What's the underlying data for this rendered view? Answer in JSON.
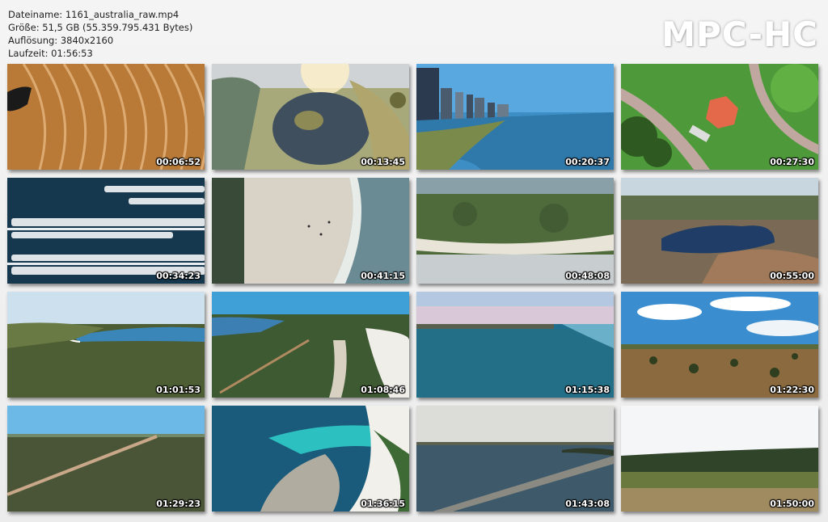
{
  "info": {
    "filename": "Dateiname: 1161_australia_raw.mp4",
    "size": "Größe: 51,5 GB (55.359.795.431 Bytes)",
    "resolution": "Auflösung: 3840x2160",
    "duration": "Laufzeit: 01:56:53"
  },
  "logo": "MPC-HC",
  "thumbnails": [
    {
      "time": "00:06:52",
      "scene": "golden-field"
    },
    {
      "time": "00:13:45",
      "scene": "lake-park"
    },
    {
      "time": "00:20:37",
      "scene": "city-skyline"
    },
    {
      "time": "00:27:30",
      "scene": "park-pavilion"
    },
    {
      "time": "00:34:23",
      "scene": "marina-boats"
    },
    {
      "time": "00:41:15",
      "scene": "beach-sand"
    },
    {
      "time": "00:48:08",
      "scene": "coastal-bush"
    },
    {
      "time": "00:55:00",
      "scene": "blue-lake"
    },
    {
      "time": "01:01:53",
      "scene": "coast-bay"
    },
    {
      "time": "01:08:46",
      "scene": "coastal-road"
    },
    {
      "time": "01:15:38",
      "scene": "sea-horizon"
    },
    {
      "time": "01:22:30",
      "scene": "dry-grassland"
    },
    {
      "time": "01:29:23",
      "scene": "bush-road"
    },
    {
      "time": "01:36:15",
      "scene": "turquoise-bay"
    },
    {
      "time": "01:43:08",
      "scene": "jetty"
    },
    {
      "time": "01:50:00",
      "scene": "forest-field"
    }
  ]
}
